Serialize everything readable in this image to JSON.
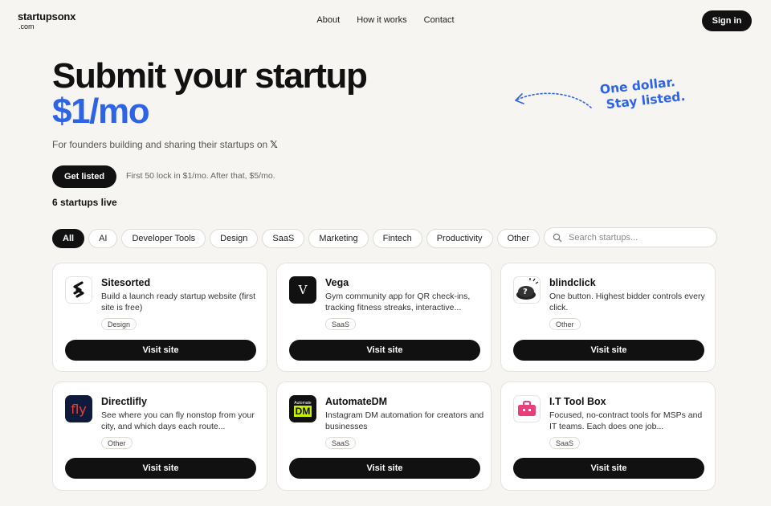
{
  "header": {
    "logo_line1": "startupsonx",
    "logo_line2": ".com",
    "nav": [
      "About",
      "How it works",
      "Contact"
    ],
    "signin_label": "Sign in"
  },
  "hero": {
    "title": "Submit your startup",
    "price": "$1/mo",
    "subtitle": "For founders building and sharing their startups on",
    "subtitle_icon": "x-logo-icon",
    "cta_label": "Get listed",
    "cta_note": "First 50 lock in $1/mo. After that, $5/mo.",
    "live_count": "6 startups live",
    "note_line1": "One dollar.",
    "note_line2": "Stay listed.",
    "accent_color": "#2d64e6"
  },
  "filters": {
    "chips": [
      "All",
      "AI",
      "Developer Tools",
      "Design",
      "SaaS",
      "Marketing",
      "Fintech",
      "Productivity",
      "Other"
    ],
    "active": "All",
    "search_placeholder": "Search startups..."
  },
  "startups": [
    {
      "name": "Sitesorted",
      "description": "Build a launch ready startup website (first site is free)",
      "tag": "Design",
      "button": "Visit site",
      "icon": "sitesorted-logo-icon"
    },
    {
      "name": "Vega",
      "description": "Gym community app for QR check-ins, tracking fitness streaks, interactive...",
      "tag": "SaaS",
      "button": "Visit site",
      "icon": "vega-logo-icon"
    },
    {
      "name": "blindclick",
      "description": "One button. Highest bidder controls every click.",
      "tag": "Other",
      "button": "Visit site",
      "icon": "blindclick-logo-icon"
    },
    {
      "name": "Directlifly",
      "description": "See where you can fly nonstop from your city, and which days each route...",
      "tag": "Other",
      "button": "Visit site",
      "icon": "directlifly-logo-icon",
      "logo_text": "fly"
    },
    {
      "name": "AutomateDM",
      "description": "Instagram DM automation for creators and businesses",
      "tag": "SaaS",
      "button": "Visit site",
      "icon": "automatedm-logo-icon",
      "logo_text": "DM",
      "logo_small": "Automate"
    },
    {
      "name": "I.T Tool Box",
      "description": "Focused, no-contract tools for MSPs and IT teams. Each does one job...",
      "tag": "SaaS",
      "button": "Visit site",
      "icon": "toolbox-logo-icon"
    }
  ]
}
